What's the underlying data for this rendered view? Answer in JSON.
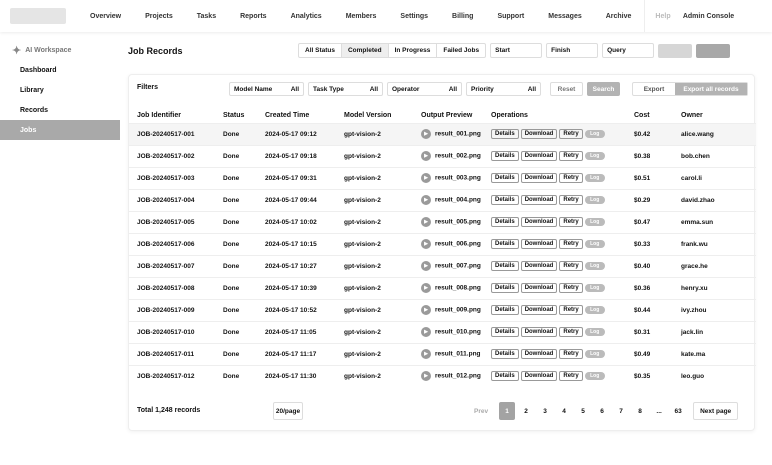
{
  "app": {
    "logo_text": ""
  },
  "topnav": {
    "items": [
      "Overview",
      "Projects",
      "Tasks",
      "Reports",
      "Analytics",
      "Members",
      "Settings",
      "Billing",
      "Support",
      "Messages",
      "Archive"
    ],
    "muted_item": "Help",
    "account_label": "Admin Console"
  },
  "sidebar": {
    "section_title": "AI Workspace",
    "items": [
      "Dashboard",
      "Library",
      "Records",
      "Jobs"
    ],
    "active_index": 3
  },
  "page": {
    "title": "Job Records"
  },
  "filters": {
    "segments": [
      "All Status",
      "Completed",
      "In Progress",
      "Failed Jobs"
    ],
    "active_segment": 1,
    "start_date": "Start",
    "end_date": "Finish",
    "keyword": "Query"
  },
  "toolbar": {
    "label": "Filters",
    "selects": [
      {
        "label": "Model Name",
        "value": "All"
      },
      {
        "label": "Task Type",
        "value": "All"
      },
      {
        "label": "Operator",
        "value": "All"
      },
      {
        "label": "Priority",
        "value": "All"
      }
    ],
    "reset_label": "Reset",
    "search_label": "Search",
    "export_label": "Export",
    "export_all_label": "Export all records"
  },
  "table": {
    "headers": [
      "Job Identifier",
      "Status",
      "Created Time",
      "Model Version",
      "Output Preview",
      "Operations",
      "Cost",
      "Owner"
    ],
    "rows": [
      {
        "id": "JOB-20240517-001",
        "status": "Done",
        "created": "2024-05-17 09:12",
        "model": "gpt-vision-2",
        "preview": "result_001.png",
        "cost": "$0.42",
        "owner": "alice.wang"
      },
      {
        "id": "JOB-20240517-002",
        "status": "Done",
        "created": "2024-05-17 09:18",
        "model": "gpt-vision-2",
        "preview": "result_002.png",
        "cost": "$0.38",
        "owner": "bob.chen"
      },
      {
        "id": "JOB-20240517-003",
        "status": "Done",
        "created": "2024-05-17 09:31",
        "model": "gpt-vision-2",
        "preview": "result_003.png",
        "cost": "$0.51",
        "owner": "carol.li"
      },
      {
        "id": "JOB-20240517-004",
        "status": "Done",
        "created": "2024-05-17 09:44",
        "model": "gpt-vision-2",
        "preview": "result_004.png",
        "cost": "$0.29",
        "owner": "david.zhao"
      },
      {
        "id": "JOB-20240517-005",
        "status": "Done",
        "created": "2024-05-17 10:02",
        "model": "gpt-vision-2",
        "preview": "result_005.png",
        "cost": "$0.47",
        "owner": "emma.sun"
      },
      {
        "id": "JOB-20240517-006",
        "status": "Done",
        "created": "2024-05-17 10:15",
        "model": "gpt-vision-2",
        "preview": "result_006.png",
        "cost": "$0.33",
        "owner": "frank.wu"
      },
      {
        "id": "JOB-20240517-007",
        "status": "Done",
        "created": "2024-05-17 10:27",
        "model": "gpt-vision-2",
        "preview": "result_007.png",
        "cost": "$0.40",
        "owner": "grace.he"
      },
      {
        "id": "JOB-20240517-008",
        "status": "Done",
        "created": "2024-05-17 10:39",
        "model": "gpt-vision-2",
        "preview": "result_008.png",
        "cost": "$0.36",
        "owner": "henry.xu"
      },
      {
        "id": "JOB-20240517-009",
        "status": "Done",
        "created": "2024-05-17 10:52",
        "model": "gpt-vision-2",
        "preview": "result_009.png",
        "cost": "$0.44",
        "owner": "ivy.zhou"
      },
      {
        "id": "JOB-20240517-010",
        "status": "Done",
        "created": "2024-05-17 11:05",
        "model": "gpt-vision-2",
        "preview": "result_010.png",
        "cost": "$0.31",
        "owner": "jack.lin"
      },
      {
        "id": "JOB-20240517-011",
        "status": "Done",
        "created": "2024-05-17 11:17",
        "model": "gpt-vision-2",
        "preview": "result_011.png",
        "cost": "$0.49",
        "owner": "kate.ma"
      },
      {
        "id": "JOB-20240517-012",
        "status": "Done",
        "created": "2024-05-17 11:30",
        "model": "gpt-vision-2",
        "preview": "result_012.png",
        "cost": "$0.35",
        "owner": "leo.guo"
      }
    ],
    "actions": {
      "view": "Details",
      "download": "Download",
      "retry": "Retry",
      "tag": "Log"
    }
  },
  "footer": {
    "total_label": "Total 1,248 records",
    "page_size": "20/page",
    "prev_label": "Prev",
    "pages": [
      "1",
      "2",
      "3",
      "4",
      "5",
      "6",
      "7",
      "8"
    ],
    "active_page": 0,
    "ellipsis": "...",
    "last_page": "63",
    "next_label": "Next page"
  }
}
